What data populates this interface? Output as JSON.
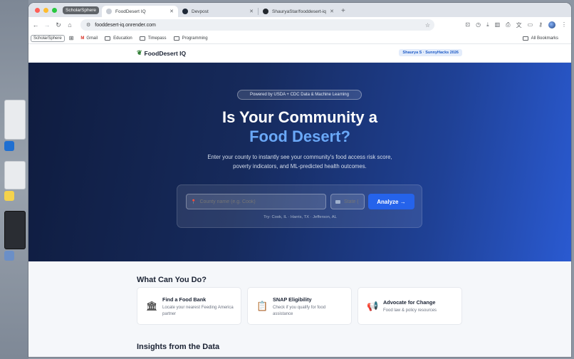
{
  "browser": {
    "tab_group": "ScholarSphere",
    "tabs": [
      {
        "title": "FoodDesert IQ",
        "active": true
      },
      {
        "title": "Devpost",
        "active": false
      },
      {
        "title": "ShauryaStar/fooddesert-iq",
        "active": false
      }
    ],
    "url": "fooddesert-iq.onrender.com",
    "bookmarks": [
      {
        "label": "ScholarSphere",
        "type": "chip"
      },
      {
        "label": "Gmail",
        "type": "link"
      },
      {
        "label": "Education",
        "type": "folder"
      },
      {
        "label": "Timepass",
        "type": "folder"
      },
      {
        "label": "Programming",
        "type": "folder"
      }
    ],
    "all_bookmarks": "All Bookmarks"
  },
  "site": {
    "brand": "FoodDesert IQ",
    "author_badge": "Shaurya S · SunnyHacks 2026"
  },
  "hero": {
    "pill": "Powered by USDA + CDC Data & Machine Learning",
    "title_line1": "Is Your Community a",
    "title_line2": "Food Desert?",
    "subtitle": "Enter your county to instantly see your community's food access risk score, poverty indicators, and ML-predicted health outcomes.",
    "county_placeholder": "County name (e.g. Cook)",
    "state_placeholder": "State (",
    "analyze_label": "Analyze →",
    "try_text": "Try: Cook, IL  ·  Harris, TX  ·  Jefferson, AL"
  },
  "what_can_you_do": {
    "title": "What Can You Do?",
    "cards": [
      {
        "icon": "bank-icon",
        "glyph": "🏛",
        "title": "Find a Food Bank",
        "desc": "Locate your nearest Feeding America partner"
      },
      {
        "icon": "clipboard-icon",
        "glyph": "📋",
        "title": "SNAP Eligibility",
        "desc": "Check if you qualify for food assistance"
      },
      {
        "icon": "megaphone-icon",
        "glyph": "📢",
        "title": "Advocate for Change",
        "desc": "Food law & policy resources"
      }
    ]
  },
  "insights": {
    "title": "Insights from the Data"
  },
  "colors": {
    "accent": "#2563eb",
    "hero_highlight": "#6aa8f7",
    "hero_dark": "#0f1c3f"
  }
}
